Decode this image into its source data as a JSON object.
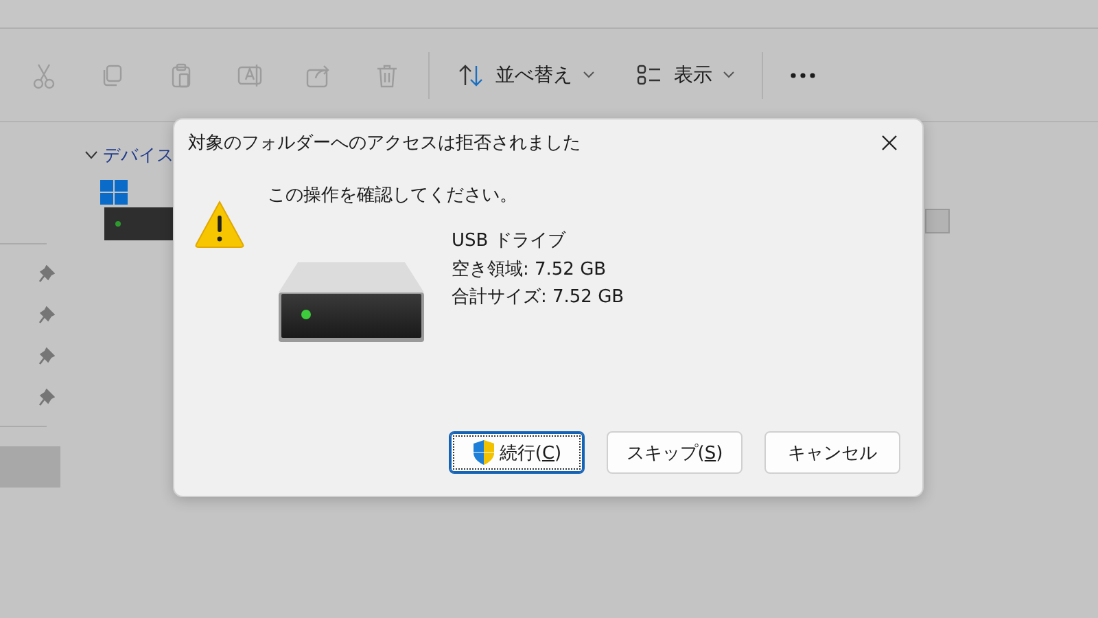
{
  "toolbar": {
    "buttons": [
      {
        "kind": "cut",
        "disabled": true
      },
      {
        "kind": "copy",
        "disabled": true
      },
      {
        "kind": "paste",
        "disabled": true
      },
      {
        "kind": "rename",
        "disabled": true
      },
      {
        "kind": "share",
        "disabled": true
      },
      {
        "kind": "delete",
        "disabled": true
      },
      {
        "kind": "sort",
        "label": "並べ替え",
        "disabled": false
      },
      {
        "kind": "view",
        "label": "表示",
        "disabled": false
      },
      {
        "kind": "more",
        "disabled": false
      }
    ]
  },
  "sidebar": {
    "items": [
      {
        "pinned": true,
        "selected": false
      },
      {
        "pinned": true,
        "selected": false
      },
      {
        "pinned": true,
        "selected": false
      },
      {
        "pinned": true,
        "selected": false
      },
      {
        "pinned": false,
        "selected": true
      }
    ]
  },
  "section": {
    "title": "デバイス",
    "expanded": true
  },
  "dialog": {
    "title": "対象のフォルダーへのアクセスは拒否されました",
    "message": "この操作を確認してください。",
    "details": [
      "USB ドライブ",
      "空き領域: 7.52 GB",
      "合計サイズ: 7.52 GB"
    ],
    "buttons": [
      {
        "label_before": "続行(",
        "access_key": "C",
        "label_after": ")",
        "shield": true,
        "default": true
      },
      {
        "label_before": "スキップ(",
        "access_key": "S",
        "label_after": ")",
        "shield": false,
        "default": false
      },
      {
        "label_before": "キャンセル",
        "shield": false,
        "default": false
      }
    ]
  }
}
